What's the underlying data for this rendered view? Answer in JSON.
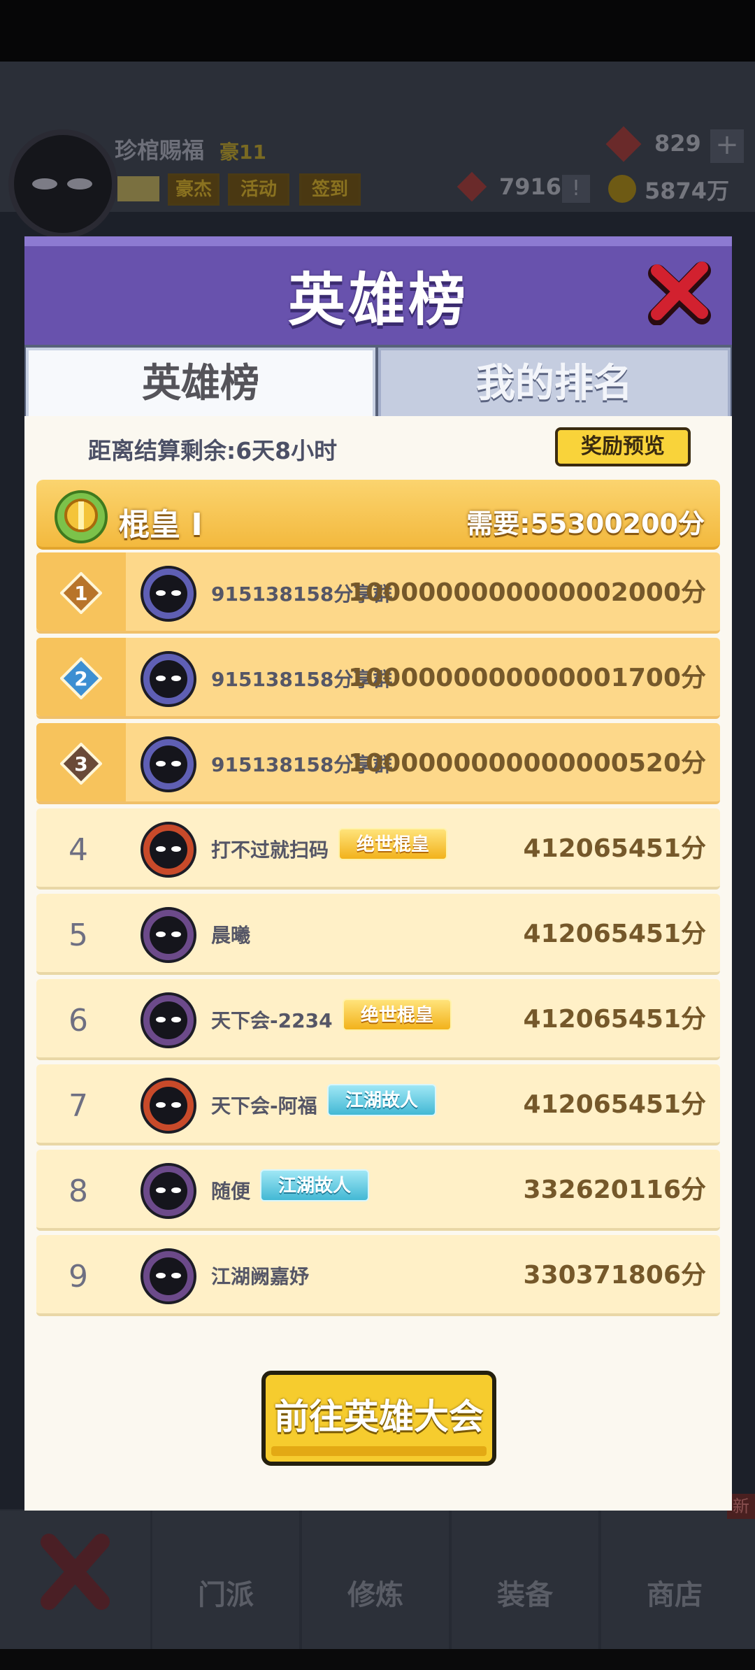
{
  "hud": {
    "player_name": "珍棺赐福",
    "rank_label": "豪11",
    "buttons": [
      "豪杰",
      "活动",
      "签到"
    ],
    "gems": "829",
    "tokens": "7916",
    "coins": "5874万"
  },
  "bottom_nav": {
    "items": [
      "门派",
      "修炼",
      "装备",
      "商店"
    ],
    "new_badge": "新"
  },
  "modal": {
    "title": "英雄榜",
    "tabs": [
      {
        "label": "英雄榜",
        "active": true
      },
      {
        "label": "我的排名",
        "active": false
      }
    ],
    "countdown": "距离结算剩余:6天8小时",
    "preview_button": "奖励预览",
    "tier": {
      "name": "棍皇 I",
      "requirement": "需要:55300200分"
    },
    "ranking": [
      {
        "rank": "1",
        "name": "915138158分享群",
        "score": "1000000000000002000分",
        "title": null,
        "title_style": null
      },
      {
        "rank": "2",
        "name": "915138158分享群",
        "score": "1000000000000001700分",
        "title": null,
        "title_style": null
      },
      {
        "rank": "3",
        "name": "915138158分享群",
        "score": "1000000000000000520分",
        "title": null,
        "title_style": null
      },
      {
        "rank": "4",
        "name": "打不过就扫码",
        "score": "412065451分",
        "title": "绝世棍皇",
        "title_style": "gold"
      },
      {
        "rank": "5",
        "name": "晨曦",
        "score": "412065451分",
        "title": null,
        "title_style": null
      },
      {
        "rank": "6",
        "name": "天下会-2234",
        "score": "412065451分",
        "title": "绝世棍皇",
        "title_style": "gold"
      },
      {
        "rank": "7",
        "name": "天下会-阿福",
        "score": "412065451分",
        "title": "江湖故人",
        "title_style": "blue"
      },
      {
        "rank": "8",
        "name": "随便",
        "score": "332620116分",
        "title": "江湖故人",
        "title_style": "blue"
      },
      {
        "rank": "9",
        "name": "江湖阙嘉妤",
        "score": "330371806分",
        "title": null,
        "title_style": null
      }
    ],
    "go_button": "前往英雄大会"
  },
  "colors": {
    "header_purple": "#6852ad",
    "tier_gold": "#f3b93e",
    "top_row": "#fdd88a",
    "normal_row": "#fff0c7",
    "score_brown": "#75582a"
  }
}
